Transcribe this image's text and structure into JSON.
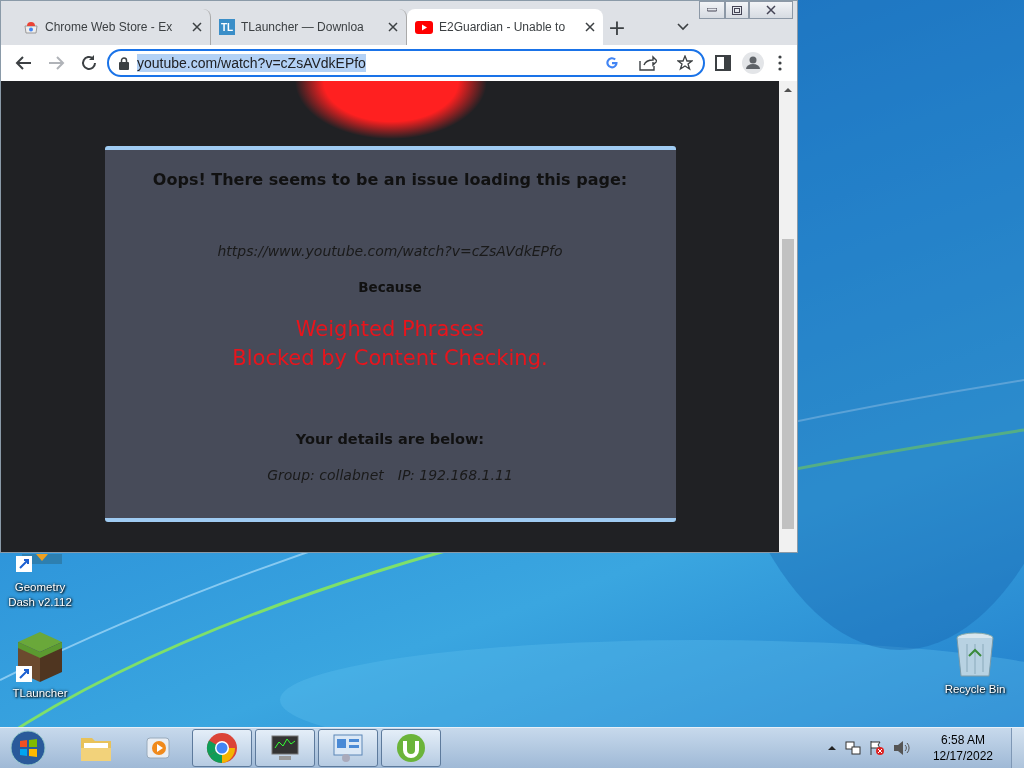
{
  "browser": {
    "tabs": [
      {
        "title": "Chrome Web Store - Ex",
        "kind": "store",
        "selected": false
      },
      {
        "title": "TLauncher — Downloa",
        "kind": "tl",
        "selected": false
      },
      {
        "title": "E2Guardian - Unable to",
        "kind": "youtube",
        "selected": true
      }
    ],
    "tl_label": "TL",
    "new_tab": "+",
    "address": "youtube.com/watch?v=cZsAVdkEPfo",
    "address_selected": true
  },
  "page": {
    "heading": "Oops! There seems to be an issue loading this page:",
    "url": "https://www.youtube.com/watch?v=cZsAVdkEPfo",
    "because": "Because",
    "reasons": [
      "Weighted Phrases",
      "Blocked by Content Checking."
    ],
    "details_heading": "Your details are below:",
    "group": "Group: collabnet",
    "ip": "IP: 192.168.1.11"
  },
  "desktop_icons": [
    {
      "label": "Geometry Dash v2.112",
      "kind": "game"
    },
    {
      "label": "TLauncher",
      "kind": "block"
    },
    {
      "label": "Recycle Bin",
      "kind": "bin"
    }
  ],
  "taskbar": {
    "apps": [
      {
        "kind": "explorer",
        "running": false
      },
      {
        "kind": "media",
        "running": false
      },
      {
        "kind": "chrome",
        "running": true
      },
      {
        "kind": "monitor",
        "running": true
      },
      {
        "kind": "panel",
        "running": true
      },
      {
        "kind": "torrent",
        "running": true
      }
    ],
    "time": "6:58 AM",
    "date": "12/17/2022"
  }
}
